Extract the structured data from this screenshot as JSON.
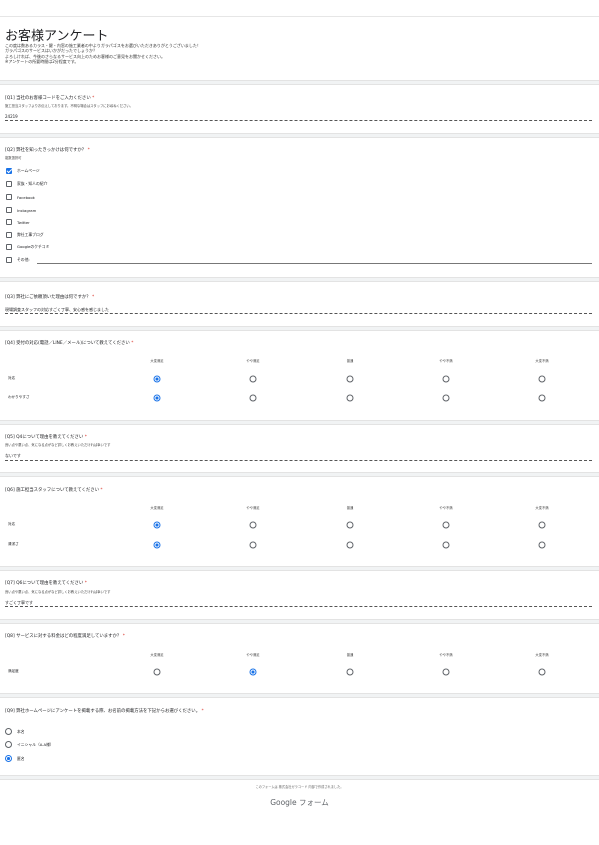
{
  "form": {
    "title": "お客様アンケート",
    "intro": [
      "この度は数あるカラス・鍵・内窓の施工業者の中よりガラパゴスをお選びいただきありがとうございました！",
      "ガラパゴスのサービスはいかがだったでしょうか？",
      "よろしければ、今後のさらなるサービス向上のためお客様のご意見をお聞かせください。",
      "※アンケートの所要時間は2分程度です。"
    ]
  },
  "q1": {
    "title": "[Q1] 当社のお客様コードをご入力ください",
    "required": "*",
    "help": "施工担当スタッフよりお伝えしております。不明な場合はスタッフにお尋ねください。",
    "answer": "24219"
  },
  "q2": {
    "title": "[Q2] 弊社を知ったきっかけは何ですか？",
    "required": "*",
    "help": "複数選択可",
    "options": [
      {
        "label": "ホームページ",
        "checked": true
      },
      {
        "label": "家族・知人の紹介",
        "checked": false
      },
      {
        "label": "Facebook",
        "checked": false
      },
      {
        "label": "Instagram",
        "checked": false
      },
      {
        "label": "Twitter",
        "checked": false
      },
      {
        "label": "弊社工事ブログ",
        "checked": false
      },
      {
        "label": "Googleのクチコミ",
        "checked": false
      },
      {
        "label": "その他:",
        "checked": false
      }
    ]
  },
  "q3": {
    "title": "[Q3] 弊社にご依頼頂いた理由は何ですか？",
    "required": "*",
    "answer": "現場調査スタッフの対応すごく丁寧、安心感を感じました"
  },
  "q4": {
    "title": "[Q4] 受付の対応(電話／LINE／メール)について教えてください",
    "required": "*",
    "columns": [
      "大変満足",
      "やや満足",
      "普通",
      "やや不満",
      "大変不満"
    ],
    "rows": [
      {
        "label": "対応",
        "selected": 0
      },
      {
        "label": "わかりやすさ",
        "selected": 0
      }
    ]
  },
  "q5": {
    "title": "[Q5] Q4について理由を教えてください",
    "required": "*",
    "help": "良い点や悪い点、気になる点がなど詳しくお教えいただければ幸いです",
    "answer": "ないです"
  },
  "q6": {
    "title": "[Q6] 施工担当スタッフについて教えてください",
    "required": "*",
    "columns": [
      "大変満足",
      "やや満足",
      "普通",
      "やや不満",
      "大変不満"
    ],
    "rows": [
      {
        "label": "対応",
        "selected": 0
      },
      {
        "label": "清潔さ",
        "selected": 0
      }
    ]
  },
  "q7": {
    "title": "[Q7] Q6について理由を教えてください",
    "required": "*",
    "help": "良い点や悪い点、気になる点がなど詳しくお教えいただければ幸いです",
    "answer": "すごく丁寧です"
  },
  "q8": {
    "title": "[Q8] サービスに対する料金はどの程度満足していますか？",
    "required": "*",
    "columns": [
      "大変満足",
      "やや満足",
      "普通",
      "やや不満",
      "大変不満"
    ],
    "rows": [
      {
        "label": "満足度",
        "selected": 1
      }
    ]
  },
  "q9": {
    "title": "[Q9] 弊社ホームページにアンケートを掲載する際、お名前の掲載方法を下記からお選びください。",
    "required": "*",
    "options": [
      {
        "label": "本名",
        "selected": false
      },
      {
        "label": "イニシャル（A.A様）",
        "selected": false
      },
      {
        "label": "匿名",
        "selected": true
      }
    ]
  },
  "footer": {
    "note": "このフォームは 株式会社ガラコード 内部で作成されました。",
    "brand": "Google フォーム"
  },
  "colors": {
    "accent": "#1a73e8",
    "required": "#d93025"
  }
}
